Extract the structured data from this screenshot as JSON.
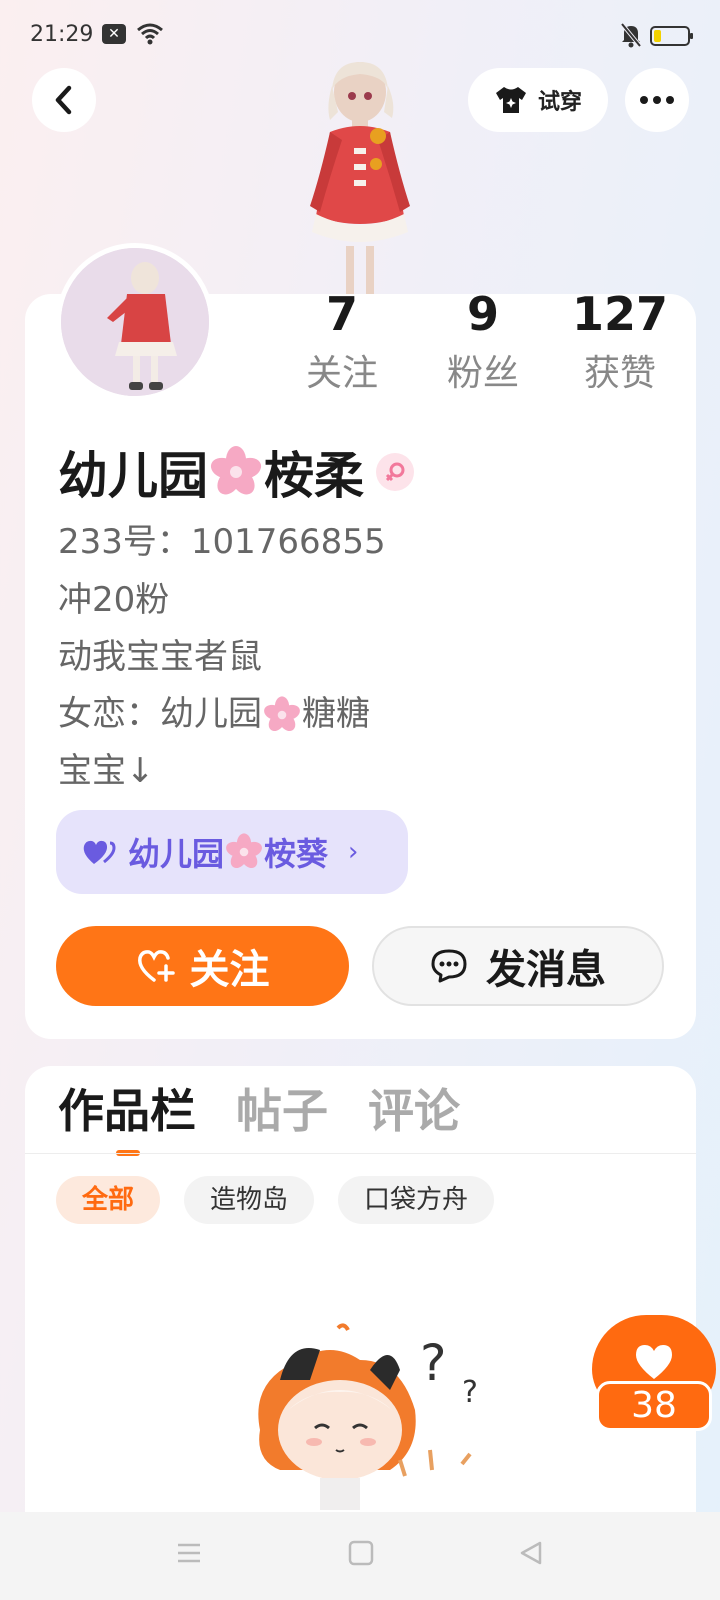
{
  "status_bar": {
    "time": "21:29",
    "icons": [
      "notification-x-icon",
      "wifi-icon",
      "mute-bell-icon",
      "battery-icon"
    ],
    "battery_level": 0.15
  },
  "header": {
    "back_icon": "chevron-left-icon",
    "tryon_label": "试穿",
    "tryon_icon": "shirt-icon",
    "more_icon": "more-dots-icon"
  },
  "profile": {
    "stats": [
      {
        "value": "7",
        "label": "关注"
      },
      {
        "value": "9",
        "label": "粉丝"
      },
      {
        "value": "127",
        "label": "获赞"
      }
    ],
    "name_part1": "幼儿园",
    "name_part2": "桉柔",
    "gender_icon": "female-icon",
    "uid": "233号：101766855",
    "bio": {
      "line1": "冲20粉",
      "line2": "动我宝宝者鼠",
      "line3_prefix": "女恋：幼儿园",
      "line3_suffix": "糖糖",
      "line4": "宝宝↓"
    },
    "cp_pill": {
      "icon": "heart-pair-icon",
      "name_part1": "幼儿园",
      "name_part2": "桉葵",
      "chevron": "›"
    },
    "follow_label": "关注",
    "message_label": "发消息"
  },
  "works": {
    "tabs": [
      {
        "label": "作品栏",
        "active": true
      },
      {
        "label": "帖子",
        "active": false
      },
      {
        "label": "评论",
        "active": false
      }
    ],
    "chips": [
      {
        "label": "全部",
        "active": true
      },
      {
        "label": "造物岛",
        "active": false
      },
      {
        "label": "口袋方舟",
        "active": false
      }
    ],
    "like_count": "38"
  },
  "colors": {
    "accent": "#ff7516",
    "cp_bg": "#e6e3fb",
    "cp_text": "#6a5be0"
  }
}
